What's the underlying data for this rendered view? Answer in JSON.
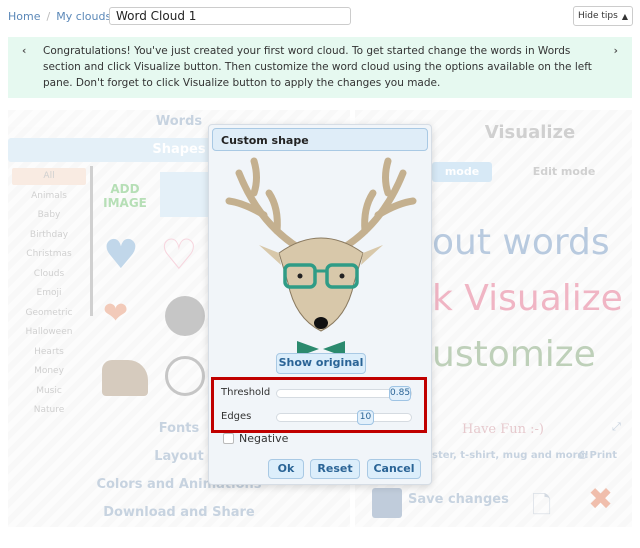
{
  "breadcrumb": {
    "home": "Home",
    "my_clouds": "My clouds"
  },
  "cloud_title": "Word Cloud 1",
  "hide_tips": "Hide tips",
  "tip": {
    "text": "Congratulations! You've just created your first word cloud. To get started change the words in Words section and click Visualize button. Then customize the word cloud using the options available on the left pane. Don't forget to click Visualize button to apply the changes you made.",
    "prev": "‹",
    "next": "›"
  },
  "left": {
    "words": "Words",
    "shapes": "Shapes",
    "categories": [
      "All",
      "Animals",
      "Baby",
      "Birthday",
      "Christmas",
      "Clouds",
      "Emoji",
      "Geometric",
      "Halloween",
      "Hearts",
      "Money",
      "Music",
      "Nature"
    ],
    "add_image": "ADD IMAGE",
    "fonts": "Fonts",
    "layout": "Layout",
    "colors": "Colors and Animations",
    "download": "Download and Share"
  },
  "right": {
    "visualize": "Visualize",
    "view_mode": "mode",
    "edit_mode": "Edit mode",
    "cloud_words": [
      "out words",
      "k Visualize",
      "ustomize"
    ],
    "have_fun": "Have Fun :-)",
    "poster": "ster, t-shirt, mug and more!",
    "print": "Print",
    "save": "Save changes"
  },
  "dialog": {
    "title": "Custom shape",
    "show_original": "Show original",
    "threshold_label": "Threshold",
    "threshold_value": "0.85",
    "threshold_fraction": 0.85,
    "edges_label": "Edges",
    "edges_value": "10",
    "edges_fraction": 0.62,
    "negative_label": "Negative",
    "negative_checked": false,
    "ok": "Ok",
    "reset": "Reset",
    "cancel": "Cancel"
  },
  "colors": {
    "highlight": "#c00000",
    "tip_bg": "#e6f9f0",
    "accent": "#2a6496"
  }
}
